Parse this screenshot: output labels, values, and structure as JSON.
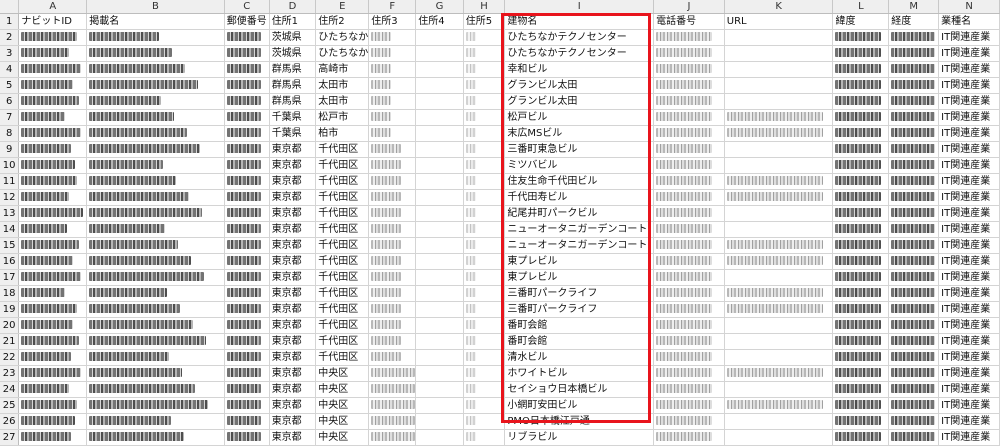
{
  "columns": [
    "A",
    "B",
    "C",
    "D",
    "E",
    "F",
    "G",
    "H",
    "I",
    "J",
    "K",
    "L",
    "M",
    "N"
  ],
  "headers": [
    "ナビットID",
    "掲載名",
    "郵便番号",
    "住所1",
    "住所2",
    "住所3",
    "住所4",
    "住所5",
    "建物名",
    "電話番号",
    "URL",
    "緯度",
    "経度",
    "業種名"
  ],
  "rows": [
    {
      "num": "2",
      "pref": "茨城県",
      "city": "ひたちなか",
      "bldg": "ひたちなかテクノセンター",
      "ind": "IT関連産業"
    },
    {
      "num": "3",
      "pref": "茨城県",
      "city": "ひたちなか",
      "bldg": "ひたちなかテクノセンター",
      "ind": "IT関連産業"
    },
    {
      "num": "4",
      "pref": "群馬県",
      "city": "高崎市",
      "bldg": "幸和ビル",
      "ind": "IT関連産業"
    },
    {
      "num": "5",
      "pref": "群馬県",
      "city": "太田市",
      "bldg": "グランビル太田",
      "ind": "IT関連産業"
    },
    {
      "num": "6",
      "pref": "群馬県",
      "city": "太田市",
      "bldg": "グランビル太田",
      "ind": "IT関連産業"
    },
    {
      "num": "7",
      "pref": "千葉県",
      "city": "松戸市",
      "bldg": "松戸ビル",
      "ind": "IT関連産業"
    },
    {
      "num": "8",
      "pref": "千葉県",
      "city": "柏市",
      "bldg": "末広MSビル",
      "ind": "IT関連産業"
    },
    {
      "num": "9",
      "pref": "東京都",
      "city": "千代田区",
      "bldg": "三番町東急ビル",
      "ind": "IT関連産業"
    },
    {
      "num": "10",
      "pref": "東京都",
      "city": "千代田区",
      "bldg": "ミツバビル",
      "ind": "IT関連産業"
    },
    {
      "num": "11",
      "pref": "東京都",
      "city": "千代田区",
      "bldg": "住友生命千代田ビル",
      "ind": "IT関連産業"
    },
    {
      "num": "12",
      "pref": "東京都",
      "city": "千代田区",
      "bldg": "千代田寿ビル",
      "ind": "IT関連産業"
    },
    {
      "num": "13",
      "pref": "東京都",
      "city": "千代田区",
      "bldg": "紀尾井町パークビル",
      "ind": "IT関連産業"
    },
    {
      "num": "14",
      "pref": "東京都",
      "city": "千代田区",
      "bldg": "ニューオータニガーデンコート",
      "ind": "IT関連産業"
    },
    {
      "num": "15",
      "pref": "東京都",
      "city": "千代田区",
      "bldg": "ニューオータニガーデンコート",
      "ind": "IT関連産業"
    },
    {
      "num": "16",
      "pref": "東京都",
      "city": "千代田区",
      "bldg": "東プレビル",
      "ind": "IT関連産業"
    },
    {
      "num": "17",
      "pref": "東京都",
      "city": "千代田区",
      "bldg": "東プレビル",
      "ind": "IT関連産業"
    },
    {
      "num": "18",
      "pref": "東京都",
      "city": "千代田区",
      "bldg": "三番町パークライフ",
      "ind": "IT関連産業"
    },
    {
      "num": "19",
      "pref": "東京都",
      "city": "千代田区",
      "bldg": "三番町パークライフ",
      "ind": "IT関連産業"
    },
    {
      "num": "20",
      "pref": "東京都",
      "city": "千代田区",
      "bldg": "番町会館",
      "ind": "IT関連産業"
    },
    {
      "num": "21",
      "pref": "東京都",
      "city": "千代田区",
      "bldg": "番町会館",
      "ind": "IT関連産業"
    },
    {
      "num": "22",
      "pref": "東京都",
      "city": "千代田区",
      "bldg": "清水ビル",
      "ind": "IT関連産業"
    },
    {
      "num": "23",
      "pref": "東京都",
      "city": "中央区",
      "bldg": "ホワイトビル",
      "ind": "IT関連産業"
    },
    {
      "num": "24",
      "pref": "東京都",
      "city": "中央区",
      "bldg": "セイショウ日本橋ビル",
      "ind": "IT関連産業"
    },
    {
      "num": "25",
      "pref": "東京都",
      "city": "中央区",
      "bldg": "小網町安田ビル",
      "ind": "IT関連産業"
    },
    {
      "num": "26",
      "pref": "東京都",
      "city": "中央区",
      "bldg": "PMO日本橋江戸通",
      "ind": "IT関連産業"
    },
    {
      "num": "27",
      "pref": "東京都",
      "city": "中央区",
      "bldg": "リブラビル",
      "ind": "IT関連産業"
    }
  ],
  "highlight": {
    "column": "I",
    "color": "#e8141c"
  }
}
